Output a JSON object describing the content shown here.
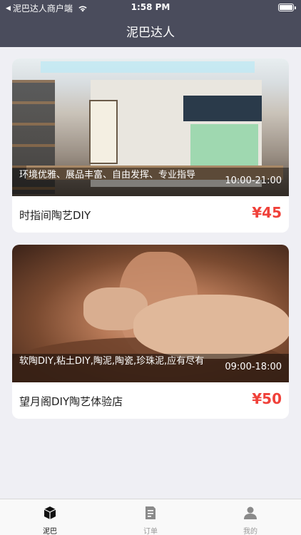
{
  "status_bar": {
    "back_app": "泥巴达人商户端",
    "time": "1:58 PM",
    "battery_level": 1.0
  },
  "nav": {
    "title": "泥巴达人"
  },
  "shops": [
    {
      "name": "时指间陶艺DIY",
      "description": "环境优雅、展品丰富、自由发挥、专业指导",
      "hours": "10:00-21:00",
      "price": "¥45"
    },
    {
      "name": "望月阁DIY陶艺体验店",
      "description": "软陶DIY,粘土DIY,陶泥,陶瓷,珍珠泥,应有尽有",
      "hours": "09:00-18:00",
      "price": "¥50"
    }
  ],
  "tabbar": {
    "items": [
      {
        "label": "泥巴",
        "icon": "cube-icon",
        "active": true
      },
      {
        "label": "订单",
        "icon": "document-icon",
        "active": false
      },
      {
        "label": "我的",
        "icon": "person-icon",
        "active": false
      }
    ]
  },
  "colors": {
    "header_bg": "#4a4c5c",
    "price": "#f0413a",
    "page_bg": "#efeff4"
  }
}
